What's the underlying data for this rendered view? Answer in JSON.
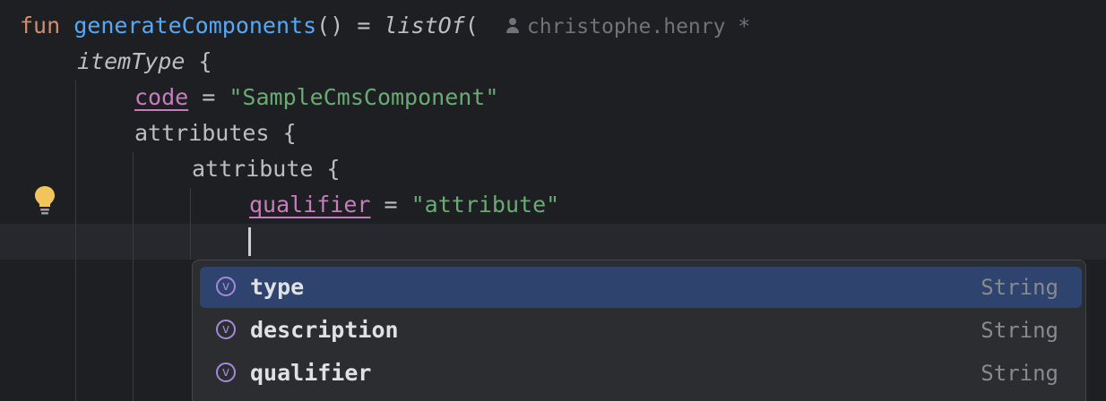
{
  "code": {
    "line1": {
      "keyword": "fun",
      "function_name": "generateComponents",
      "parens": "()",
      "equals": " = ",
      "call": "listOf",
      "open_paren": "(",
      "author": "christophe.henry",
      "author_suffix": "*"
    },
    "line2": {
      "name": "itemType",
      "brace": " {"
    },
    "line3": {
      "property": "code",
      "equals": " = ",
      "value": "\"SampleCmsComponent\""
    },
    "line4": {
      "name": "attributes",
      "brace": " {"
    },
    "line5": {
      "name": "attribute",
      "brace": " {"
    },
    "line6": {
      "property": "qualifier",
      "equals": " = ",
      "value": "\"attribute\""
    }
  },
  "completion": {
    "badge_letter": "v",
    "items": [
      {
        "name": "type",
        "type": "String"
      },
      {
        "name": "description",
        "type": "String"
      },
      {
        "name": "qualifier",
        "type": "String"
      }
    ]
  },
  "colors": {
    "background": "#1e1f22",
    "keyword": "#cf8e6d",
    "function": "#56a8f5",
    "string": "#6aab73",
    "property": "#c77dbb",
    "selection": "#2e436e",
    "badge": "#a688d9"
  },
  "icons": {
    "gutter": "lightbulb-icon",
    "author": "user-icon",
    "completion_kind": "variable-icon"
  }
}
